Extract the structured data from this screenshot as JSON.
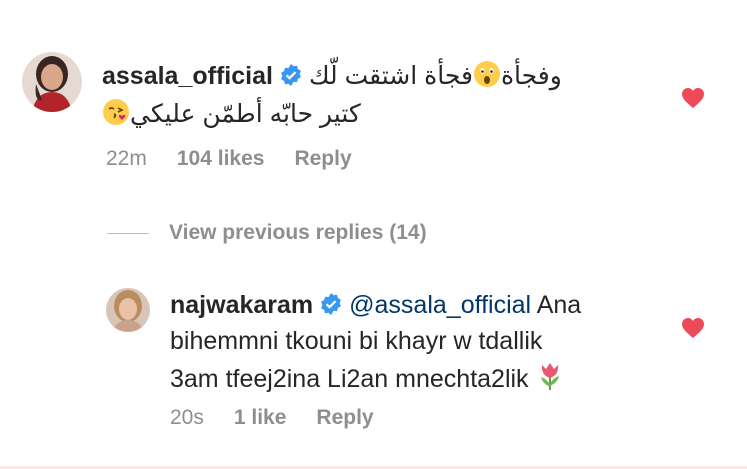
{
  "comments": [
    {
      "username": "assala_official",
      "text_line1": "فجأة اشتقت لّك",
      "text_line1_after": "وفجأة",
      "text_line2": "كتير حابّه أطمّن عليكي",
      "time": "22m",
      "likes": "104 likes",
      "reply": "Reply",
      "emojis": [
        "astonished-face",
        "face-blowing-kiss"
      ]
    },
    {
      "username": "najwakaram",
      "mention": "@assala_official",
      "text_line1": "Ana",
      "text_line2": "bihemmni tkouni bi khayr w tdallik",
      "text_line3": "3am tfeej2ina Li2an mnechta2lik",
      "time": "20s",
      "likes": "1 like",
      "reply": "Reply",
      "emojis": [
        "tulip"
      ]
    }
  ],
  "view_previous": "View previous replies (14)",
  "colors": {
    "heart": "#ed4956",
    "verified": "#3897f0",
    "mention": "#00376b",
    "meta": "#8e8e8e"
  }
}
